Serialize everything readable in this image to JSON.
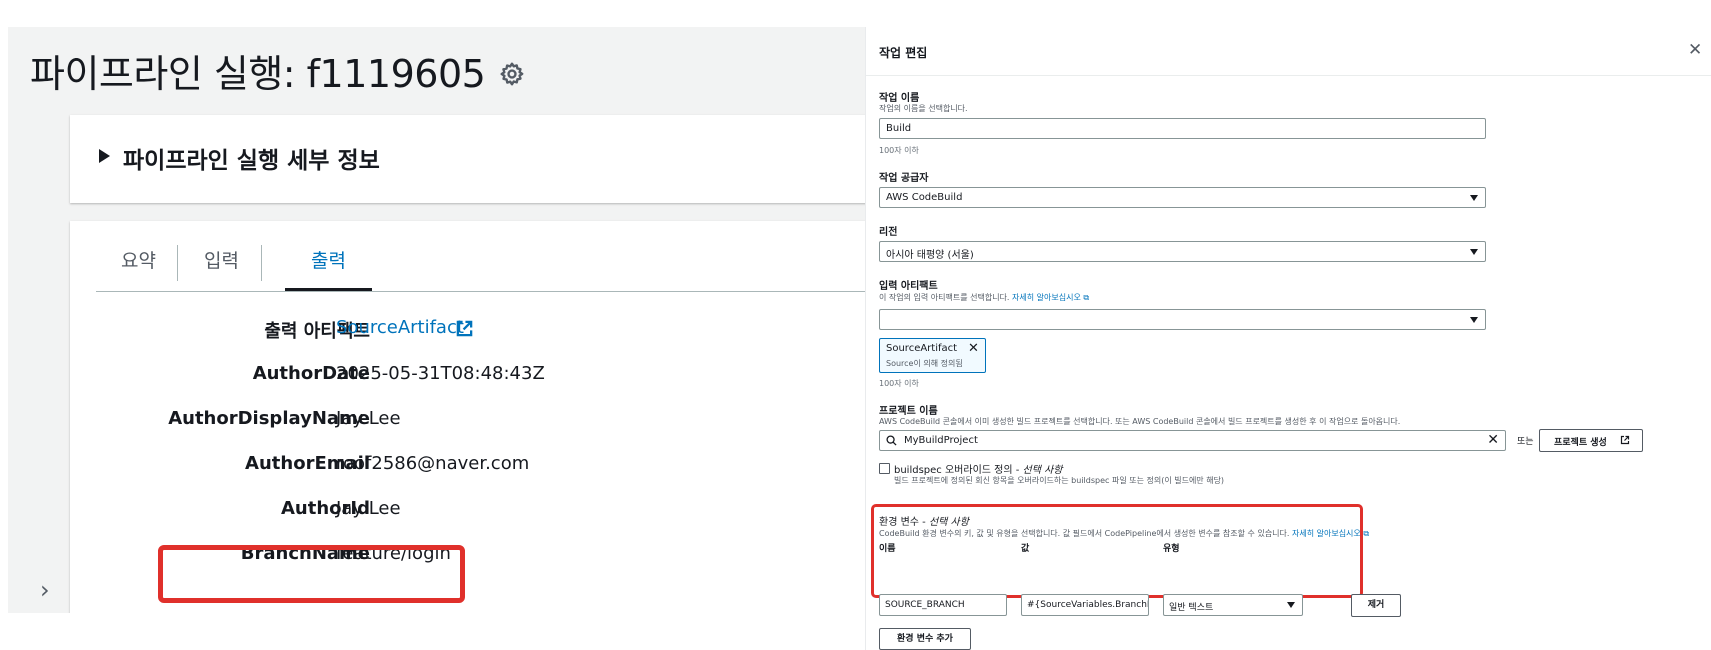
{
  "pipeline": {
    "title": "파이프라인 실행: f1119605",
    "details_title": "파이프라인 실행 세부 정보",
    "tabs": [
      {
        "label": "요약"
      },
      {
        "label": "입력"
      },
      {
        "label": "출력",
        "active": true
      }
    ],
    "outputs": [
      {
        "key": "출력 아티팩트",
        "value": "SourceArtifact",
        "link": true
      },
      {
        "key": "AuthorDate",
        "value": "2025-05-31T08:48:43Z"
      },
      {
        "key": "AuthorDisplayName",
        "value": "Jay Lee"
      },
      {
        "key": "AuthorEmail",
        "value": "roof2586@naver.com"
      },
      {
        "key": "AuthorId",
        "value": "Jay Lee"
      },
      {
        "key": "BranchName",
        "value": "feature/login"
      }
    ]
  },
  "drawer": {
    "title": "작업 편집",
    "action_name": {
      "label": "작업 이름",
      "description": "작업의 이름을 선택합니다.",
      "value": "Build",
      "hint": "100자 이하"
    },
    "provider": {
      "label": "작업 공급자",
      "value": "AWS CodeBuild"
    },
    "region": {
      "label": "리전",
      "value": "아시아 태평양 (서울)"
    },
    "input_artifacts": {
      "label": "입력 아티팩트",
      "description": "이 작업의 입력 아티팩트를 선택합니다.",
      "learn_more": "자세히 알아보십시오",
      "token_name": "SourceArtifact",
      "token_sub": "Source이 의해 정의됨",
      "hint": "100자 이하"
    },
    "project": {
      "label": "프로젝트 이름",
      "description": "AWS CodeBuild 콘솔에서 이미 생성한 빌드 프로젝트를 선택합니다. 또는 AWS CodeBuild 콘솔에서 빌드 프로젝트를 생성한 후 이 작업으로 돌아옵니다.",
      "value": "MyBuildProject",
      "or_text": "또는",
      "create_button": "프로젝트 생성"
    },
    "buildspec": {
      "label": "buildspec 오버라이드 정의 - ",
      "optional": "선택 사항",
      "description": "빌드 프로젝트에 정의된 회신 항목을 오버라이드하는 buildspec 파일 또는 정의(이 빌드에만 해당)"
    },
    "env": {
      "label": "환경 변수 - ",
      "optional": "선택 사항",
      "description": "CodeBuild 환경 변수의 키, 값 및 유형을 선택합니다. 값 필드에서 CodePipeline에서 생성한 변수를 참조할 수 있습니다.",
      "learn_more": "자세히 알아보십시오",
      "col_name": "이름",
      "col_value": "값",
      "col_type": "유형",
      "name_value": "SOURCE_BRANCH",
      "value_value": "#{SourceVariables.BranchName}",
      "type_value": "일반 텍스트",
      "remove_button": "제거",
      "add_button": "환경 변수 추가"
    }
  },
  "colors": {
    "accent": "#0073bb",
    "highlight": "#e0302b"
  }
}
